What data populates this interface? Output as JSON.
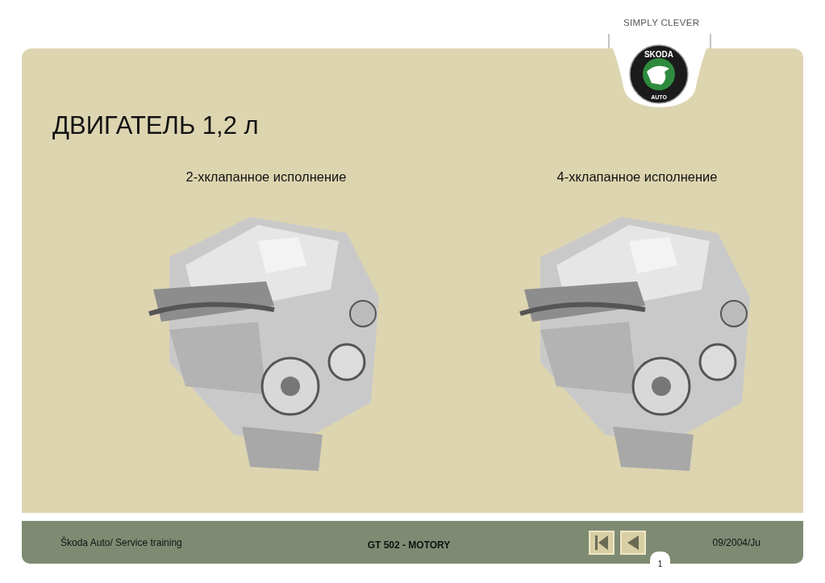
{
  "tagline": "SIMPLY CLEVER",
  "logo": {
    "top_text": "SKODA",
    "bottom_text": "AUTO"
  },
  "title": "ДВИГАТЕЛЬ 1,2 л",
  "variants": [
    {
      "caption": "2-хклапанное исполнение"
    },
    {
      "caption": "4-хклапанное исполнение"
    }
  ],
  "footer": {
    "left": "Škoda Auto/ Service training",
    "center": "GT 502 - MOTORY",
    "nav_buttons": [
      {
        "kind": "first"
      },
      {
        "kind": "previous"
      }
    ],
    "date": "09/2004/Ju",
    "page": "1"
  }
}
